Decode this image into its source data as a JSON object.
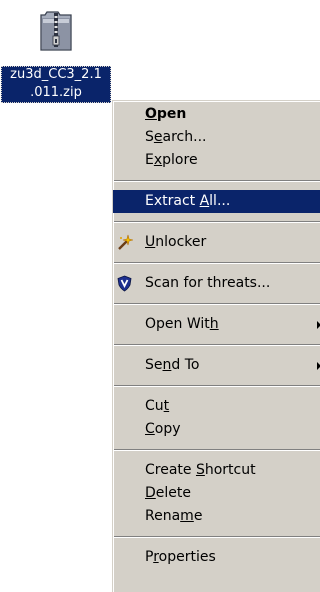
{
  "desktop_item": {
    "icon": "zip-folder-icon",
    "name_line1": "zu3d_CC3_2.1",
    "name_line2": ".011.zip"
  },
  "context_menu": {
    "groups": [
      [
        {
          "label_before": "",
          "accel": "O",
          "label_after": "pen",
          "default": true
        },
        {
          "label_before": "S",
          "accel": "e",
          "label_after": "arch..."
        },
        {
          "label_before": "E",
          "accel": "x",
          "label_after": "plore"
        }
      ],
      [
        {
          "label_before": "Extract ",
          "accel": "A",
          "label_after": "ll...",
          "highlighted": true
        }
      ],
      [
        {
          "label_before": "",
          "accel": "U",
          "label_after": "nlocker",
          "icon": "unlocker-wand-icon"
        }
      ],
      [
        {
          "label_before": "Scan for threats...",
          "accel": "",
          "label_after": "",
          "icon": "shield-antivirus-icon"
        }
      ],
      [
        {
          "label_before": "Open Wit",
          "accel": "h",
          "label_after": "",
          "submenu": true
        }
      ],
      [
        {
          "label_before": "Se",
          "accel": "n",
          "label_after": "d To",
          "submenu": true
        }
      ],
      [
        {
          "label_before": "Cu",
          "accel": "t",
          "label_after": ""
        },
        {
          "label_before": "",
          "accel": "C",
          "label_after": "opy"
        }
      ],
      [
        {
          "label_before": "Create ",
          "accel": "S",
          "label_after": "hortcut"
        },
        {
          "label_before": "",
          "accel": "D",
          "label_after": "elete"
        },
        {
          "label_before": "Rena",
          "accel": "m",
          "label_after": "e"
        }
      ],
      [
        {
          "label_before": "P",
          "accel": "r",
          "label_after": "operties"
        }
      ]
    ]
  },
  "colors": {
    "menu_bg": "#d4d0c8",
    "highlight": "#0a246a",
    "highlight_text": "#ffffff"
  }
}
